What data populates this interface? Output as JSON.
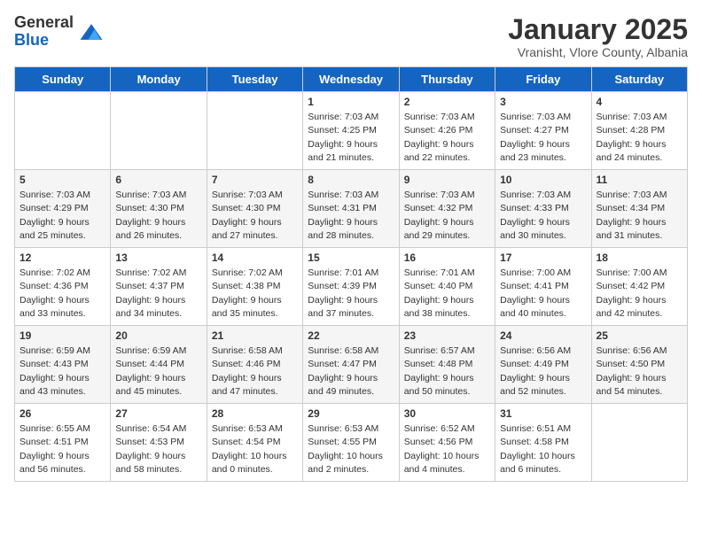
{
  "header": {
    "logo_general": "General",
    "logo_blue": "Blue",
    "month_title": "January 2025",
    "subtitle": "Vranisht, Vlore County, Albania"
  },
  "days_of_week": [
    "Sunday",
    "Monday",
    "Tuesday",
    "Wednesday",
    "Thursday",
    "Friday",
    "Saturday"
  ],
  "weeks": [
    [
      {
        "day": "",
        "info": ""
      },
      {
        "day": "",
        "info": ""
      },
      {
        "day": "",
        "info": ""
      },
      {
        "day": "1",
        "info": "Sunrise: 7:03 AM\nSunset: 4:25 PM\nDaylight: 9 hours\nand 21 minutes."
      },
      {
        "day": "2",
        "info": "Sunrise: 7:03 AM\nSunset: 4:26 PM\nDaylight: 9 hours\nand 22 minutes."
      },
      {
        "day": "3",
        "info": "Sunrise: 7:03 AM\nSunset: 4:27 PM\nDaylight: 9 hours\nand 23 minutes."
      },
      {
        "day": "4",
        "info": "Sunrise: 7:03 AM\nSunset: 4:28 PM\nDaylight: 9 hours\nand 24 minutes."
      }
    ],
    [
      {
        "day": "5",
        "info": "Sunrise: 7:03 AM\nSunset: 4:29 PM\nDaylight: 9 hours\nand 25 minutes."
      },
      {
        "day": "6",
        "info": "Sunrise: 7:03 AM\nSunset: 4:30 PM\nDaylight: 9 hours\nand 26 minutes."
      },
      {
        "day": "7",
        "info": "Sunrise: 7:03 AM\nSunset: 4:30 PM\nDaylight: 9 hours\nand 27 minutes."
      },
      {
        "day": "8",
        "info": "Sunrise: 7:03 AM\nSunset: 4:31 PM\nDaylight: 9 hours\nand 28 minutes."
      },
      {
        "day": "9",
        "info": "Sunrise: 7:03 AM\nSunset: 4:32 PM\nDaylight: 9 hours\nand 29 minutes."
      },
      {
        "day": "10",
        "info": "Sunrise: 7:03 AM\nSunset: 4:33 PM\nDaylight: 9 hours\nand 30 minutes."
      },
      {
        "day": "11",
        "info": "Sunrise: 7:03 AM\nSunset: 4:34 PM\nDaylight: 9 hours\nand 31 minutes."
      }
    ],
    [
      {
        "day": "12",
        "info": "Sunrise: 7:02 AM\nSunset: 4:36 PM\nDaylight: 9 hours\nand 33 minutes."
      },
      {
        "day": "13",
        "info": "Sunrise: 7:02 AM\nSunset: 4:37 PM\nDaylight: 9 hours\nand 34 minutes."
      },
      {
        "day": "14",
        "info": "Sunrise: 7:02 AM\nSunset: 4:38 PM\nDaylight: 9 hours\nand 35 minutes."
      },
      {
        "day": "15",
        "info": "Sunrise: 7:01 AM\nSunset: 4:39 PM\nDaylight: 9 hours\nand 37 minutes."
      },
      {
        "day": "16",
        "info": "Sunrise: 7:01 AM\nSunset: 4:40 PM\nDaylight: 9 hours\nand 38 minutes."
      },
      {
        "day": "17",
        "info": "Sunrise: 7:00 AM\nSunset: 4:41 PM\nDaylight: 9 hours\nand 40 minutes."
      },
      {
        "day": "18",
        "info": "Sunrise: 7:00 AM\nSunset: 4:42 PM\nDaylight: 9 hours\nand 42 minutes."
      }
    ],
    [
      {
        "day": "19",
        "info": "Sunrise: 6:59 AM\nSunset: 4:43 PM\nDaylight: 9 hours\nand 43 minutes."
      },
      {
        "day": "20",
        "info": "Sunrise: 6:59 AM\nSunset: 4:44 PM\nDaylight: 9 hours\nand 45 minutes."
      },
      {
        "day": "21",
        "info": "Sunrise: 6:58 AM\nSunset: 4:46 PM\nDaylight: 9 hours\nand 47 minutes."
      },
      {
        "day": "22",
        "info": "Sunrise: 6:58 AM\nSunset: 4:47 PM\nDaylight: 9 hours\nand 49 minutes."
      },
      {
        "day": "23",
        "info": "Sunrise: 6:57 AM\nSunset: 4:48 PM\nDaylight: 9 hours\nand 50 minutes."
      },
      {
        "day": "24",
        "info": "Sunrise: 6:56 AM\nSunset: 4:49 PM\nDaylight: 9 hours\nand 52 minutes."
      },
      {
        "day": "25",
        "info": "Sunrise: 6:56 AM\nSunset: 4:50 PM\nDaylight: 9 hours\nand 54 minutes."
      }
    ],
    [
      {
        "day": "26",
        "info": "Sunrise: 6:55 AM\nSunset: 4:51 PM\nDaylight: 9 hours\nand 56 minutes."
      },
      {
        "day": "27",
        "info": "Sunrise: 6:54 AM\nSunset: 4:53 PM\nDaylight: 9 hours\nand 58 minutes."
      },
      {
        "day": "28",
        "info": "Sunrise: 6:53 AM\nSunset: 4:54 PM\nDaylight: 10 hours\nand 0 minutes."
      },
      {
        "day": "29",
        "info": "Sunrise: 6:53 AM\nSunset: 4:55 PM\nDaylight: 10 hours\nand 2 minutes."
      },
      {
        "day": "30",
        "info": "Sunrise: 6:52 AM\nSunset: 4:56 PM\nDaylight: 10 hours\nand 4 minutes."
      },
      {
        "day": "31",
        "info": "Sunrise: 6:51 AM\nSunset: 4:58 PM\nDaylight: 10 hours\nand 6 minutes."
      },
      {
        "day": "",
        "info": ""
      }
    ]
  ]
}
